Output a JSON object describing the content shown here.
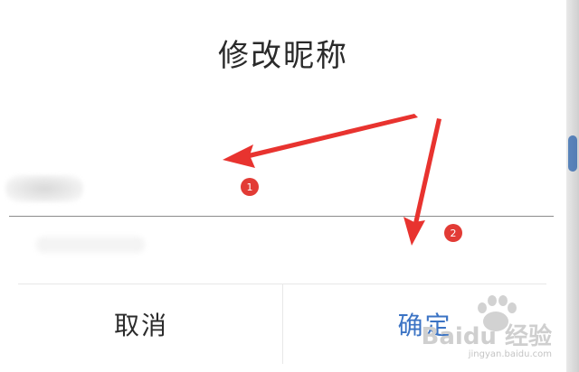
{
  "dialog": {
    "title": "修改昵称",
    "input_value": "",
    "cancel_label": "取消",
    "confirm_label": "确定",
    "confirm_color": "#3b73c4"
  },
  "annotations": {
    "marker_1": "1",
    "marker_2": "2",
    "arrow_color": "#e8332f"
  },
  "watermark": {
    "brand": "Baidu 经验",
    "url": "jingyan.baidu.com"
  }
}
